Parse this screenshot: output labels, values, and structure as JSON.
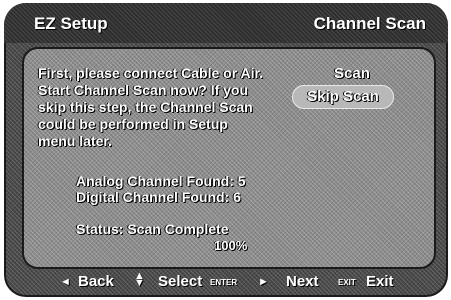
{
  "header": {
    "left_title": "EZ Setup",
    "right_title": "Channel Scan"
  },
  "main": {
    "instruction": "First, please connect Cable or Air.\nStart Channel Scan now? If you\nskip this step, the Channel Scan\ncould be performed in Setup\nmenu later.",
    "scan_button": "Scan",
    "skip_button": "Skip Scan",
    "analog_found": "Analog Channel Found: 5",
    "digital_found": "Digital Channel Found: 6",
    "status": "Status:  Scan Complete",
    "progress_text": "100%",
    "progress": 1.0
  },
  "footer": {
    "back_icon": "◄",
    "back_label": "Back",
    "select_icon": "▲▼",
    "select_label": "Select",
    "enter_label": "ENTER",
    "next_icon": "►",
    "next_label": "Next",
    "exit_key": "EXIT",
    "exit_label": "Exit"
  },
  "colors": {
    "panel": "#4a4a4a",
    "content": "#8c8c8c",
    "highlight": "#b8b8b8",
    "text": "#ffffff"
  }
}
